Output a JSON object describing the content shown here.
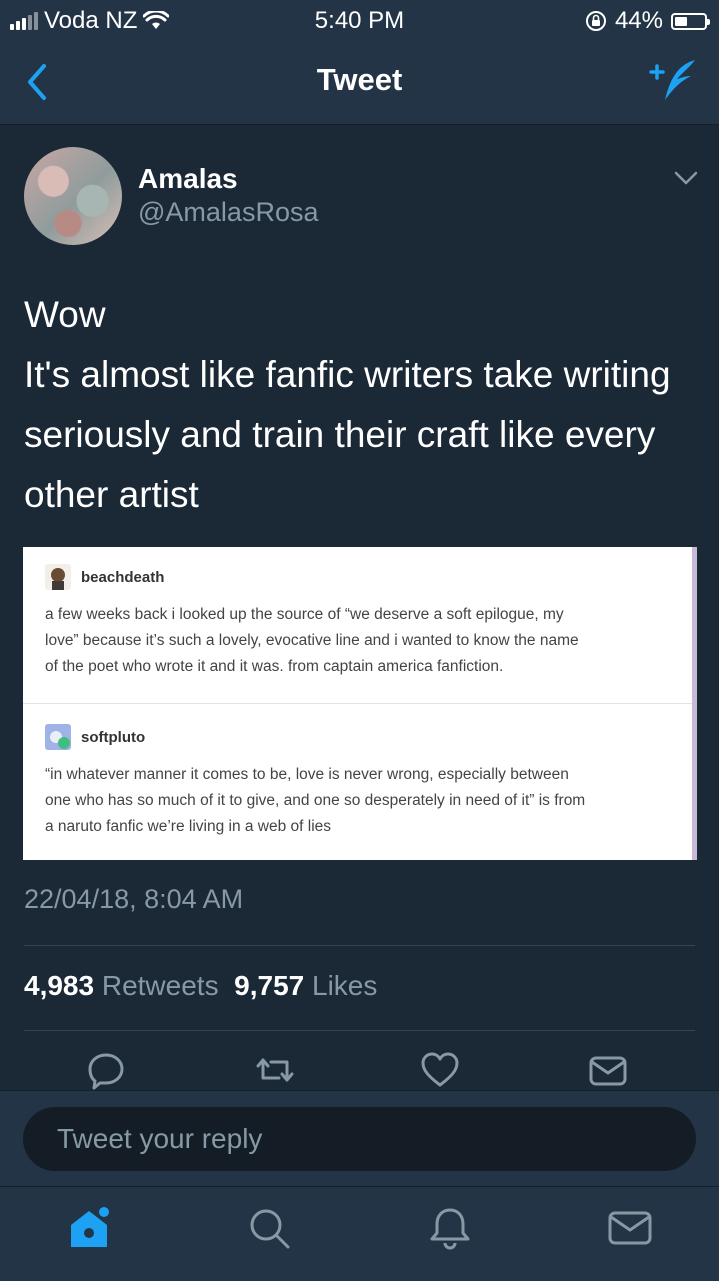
{
  "status_bar": {
    "carrier": "Voda NZ",
    "time": "5:40 PM",
    "battery": "44%",
    "battery_level": 0.44
  },
  "nav": {
    "title": "Tweet",
    "back_icon": "chevron-left-icon",
    "compose_icon": "compose-tweet-icon"
  },
  "tweet": {
    "name": "Amalas",
    "handle": "@AmalasRosa",
    "text_lines": [
      "Wow",
      "It's almost like fanfic writers take writing",
      "seriously and train their craft like every",
      "other artist"
    ],
    "image": {
      "posts": [
        {
          "user": "beachdeath",
          "lines": [
            "a few weeks back i looked up the source of “we deserve a soft epilogue, my",
            "love” because it’s such a lovely, evocative line and i wanted to know the name",
            "of the poet who wrote it and it was. from captain america fanfiction."
          ]
        },
        {
          "user": "softpluto",
          "lines": [
            "“in whatever manner it comes to be, love is never wrong, especially between",
            "one who has so much of it to give, and one so desperately in need of it” is from",
            "a naruto fanfic we’re living in a web of lies"
          ]
        }
      ]
    },
    "timestamp": "22/04/18, 8:04 AM",
    "retweets_count": "4,983",
    "retweets_label": "Retweets",
    "likes_count": "9,757",
    "likes_label": "Likes"
  },
  "reply": {
    "placeholder": "Tweet your reply"
  },
  "colors": {
    "accent": "#1da1f2",
    "background": "#1b2835",
    "bar": "#243447",
    "muted": "#8899a6"
  }
}
